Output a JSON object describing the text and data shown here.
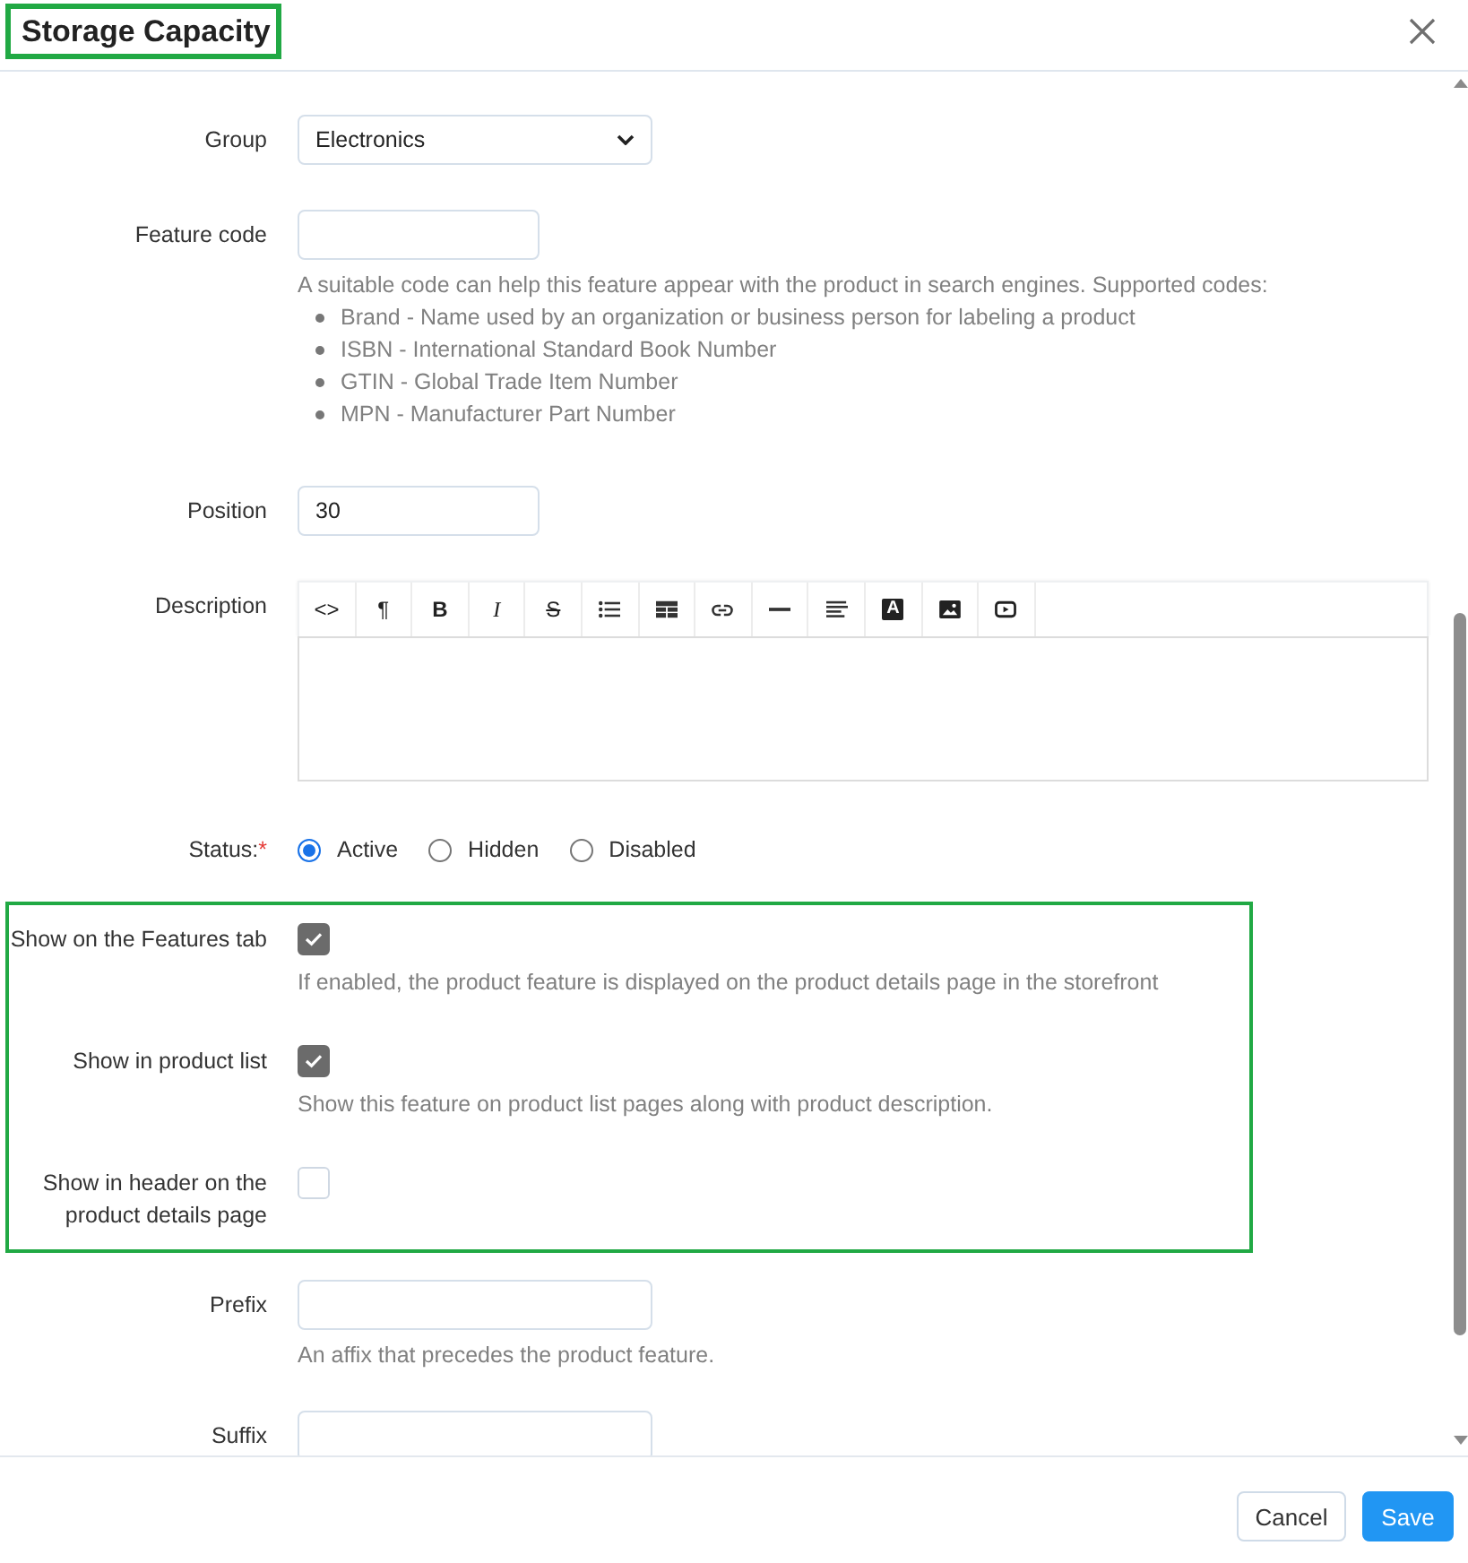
{
  "dialog": {
    "title": "Storage Capacity",
    "title_highlighted": true
  },
  "form": {
    "group": {
      "label": "Group",
      "value": "Electronics"
    },
    "feature_code": {
      "label": "Feature code",
      "help": "A suitable code can help this feature appear with the product in search engines. Supported codes:",
      "codes": [
        "Brand - Name used by an organization or business person for labeling a product",
        "ISBN - International Standard Book Number",
        "GTIN - Global Trade Item Number",
        "MPN - Manufacturer Part Number"
      ]
    },
    "position": {
      "label": "Position",
      "value": "30"
    },
    "description": {
      "label": "Description",
      "toolbar": [
        {
          "kind": "code",
          "label": "<>"
        },
        {
          "kind": "paragraph",
          "label": "¶"
        },
        {
          "kind": "bold",
          "label": "B"
        },
        {
          "kind": "italic",
          "label": "I"
        },
        {
          "kind": "strike",
          "label": "S"
        },
        {
          "kind": "list"
        },
        {
          "kind": "table"
        },
        {
          "kind": "link"
        },
        {
          "kind": "rule"
        },
        {
          "kind": "align"
        },
        {
          "kind": "color",
          "label": "A"
        },
        {
          "kind": "image"
        },
        {
          "kind": "video"
        }
      ]
    },
    "status": {
      "label": "Status:",
      "required_mark": "*",
      "options": [
        {
          "label": "Active",
          "selected": true
        },
        {
          "label": "Hidden",
          "selected": false
        },
        {
          "label": "Disabled",
          "selected": false
        }
      ]
    },
    "display_options": {
      "highlighted": true,
      "items": [
        {
          "label": "Show on the Features tab",
          "checked": true,
          "help": "If enabled, the product feature is displayed on the product details page in the storefront"
        },
        {
          "label": "Show in product list",
          "checked": true,
          "help": "Show this feature on product list pages along with product description."
        },
        {
          "label": "Show in header on the product details page",
          "checked": false
        }
      ]
    },
    "prefix": {
      "label": "Prefix",
      "help": "An affix that precedes the product feature."
    },
    "suffix": {
      "label": "Suffix"
    }
  },
  "buttons": [
    {
      "label": "Cancel",
      "kind": "secondary"
    },
    {
      "label": "Save",
      "kind": "primary"
    }
  ]
}
